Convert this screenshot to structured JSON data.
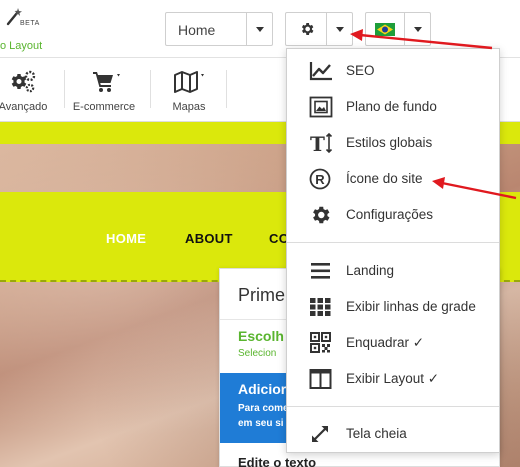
{
  "logo": {
    "badge": "BETA",
    "subtitle": "o Layout",
    "icon": "magic-wand-icon"
  },
  "header": {
    "page_select": {
      "value": "Home"
    },
    "settings_button": {
      "icon": "gear-icon"
    },
    "language_button": {
      "icon": "brazil-flag-icon"
    }
  },
  "toolbar": {
    "items": [
      {
        "label": "Avançado",
        "icon": "gears-icon"
      },
      {
        "label": "E-commerce",
        "icon": "cart-icon"
      },
      {
        "label": "Mapas",
        "icon": "map-icon"
      }
    ]
  },
  "site_nav": {
    "items": [
      "HOME",
      "ABOUT",
      "CO"
    ]
  },
  "side_panel": {
    "title": "Prime",
    "section1_title": "Escolh",
    "section1_sub": "Selecion",
    "section2_title": "Adicior",
    "section2_sub_line1": "Para come",
    "section2_sub_line2": "em seu si",
    "section3_title": "Edite o texto"
  },
  "settings_menu": {
    "groups": [
      [
        {
          "label": "SEO",
          "icon": "chart-line-icon"
        },
        {
          "label": "Plano de fundo",
          "icon": "background-image-icon"
        },
        {
          "label": "Estilos globais",
          "icon": "text-height-icon"
        },
        {
          "label": "Ícone do site",
          "icon": "registered-icon"
        },
        {
          "label": "Configurações",
          "icon": "gear-icon"
        }
      ],
      [
        {
          "label": "Landing",
          "icon": "hamburger-icon"
        },
        {
          "label": "Exibir linhas de grade",
          "icon": "grid-icon"
        },
        {
          "label": "Enquadrar ✓",
          "icon": "qrcode-icon"
        },
        {
          "label": "Exibir Layout ✓",
          "icon": "columns-icon"
        }
      ],
      [
        {
          "label": "Tela cheia",
          "icon": "expand-arrows-icon"
        }
      ]
    ]
  },
  "colors": {
    "accent_yellow": "#dbe80c",
    "brand_green": "#5ab52f",
    "primary_blue": "#1f7cd6",
    "annotation_red": "#e0191f"
  }
}
